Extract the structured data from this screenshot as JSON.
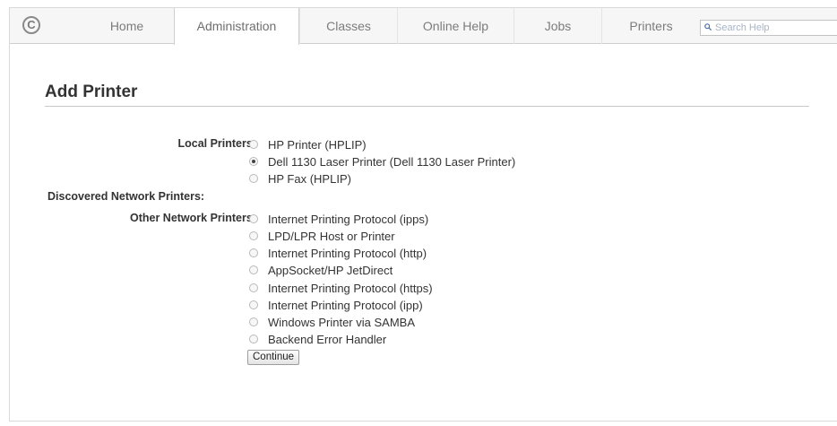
{
  "nav": {
    "tabs": [
      {
        "label": "Home"
      },
      {
        "label": "Administration"
      },
      {
        "label": "Classes"
      },
      {
        "label": "Online Help"
      },
      {
        "label": "Jobs"
      },
      {
        "label": "Printers"
      }
    ],
    "active_tab": "Administration",
    "search_placeholder": "Search Help",
    "logo_icon": "cups-logo-icon"
  },
  "page": {
    "title": "Add Printer"
  },
  "sections": {
    "local": {
      "label": "Local Printers:",
      "options": [
        {
          "label": "HP Printer (HPLIP)",
          "checked": false
        },
        {
          "label": "Dell 1130 Laser Printer (Dell 1130 Laser Printer)",
          "checked": true
        },
        {
          "label": "HP Fax (HPLIP)",
          "checked": false
        }
      ]
    },
    "discovered": {
      "label": "Discovered Network Printers:"
    },
    "other": {
      "label": "Other Network Printers:",
      "options": [
        {
          "label": "Internet Printing Protocol (ipps)",
          "checked": false
        },
        {
          "label": "LPD/LPR Host or Printer",
          "checked": false
        },
        {
          "label": "Internet Printing Protocol (http)",
          "checked": false
        },
        {
          "label": "AppSocket/HP JetDirect",
          "checked": false
        },
        {
          "label": "Internet Printing Protocol (https)",
          "checked": false
        },
        {
          "label": "Internet Printing Protocol (ipp)",
          "checked": false
        },
        {
          "label": "Windows Printer via SAMBA",
          "checked": false
        },
        {
          "label": "Backend Error Handler",
          "checked": false
        }
      ]
    }
  },
  "buttons": {
    "continue": "Continue"
  }
}
